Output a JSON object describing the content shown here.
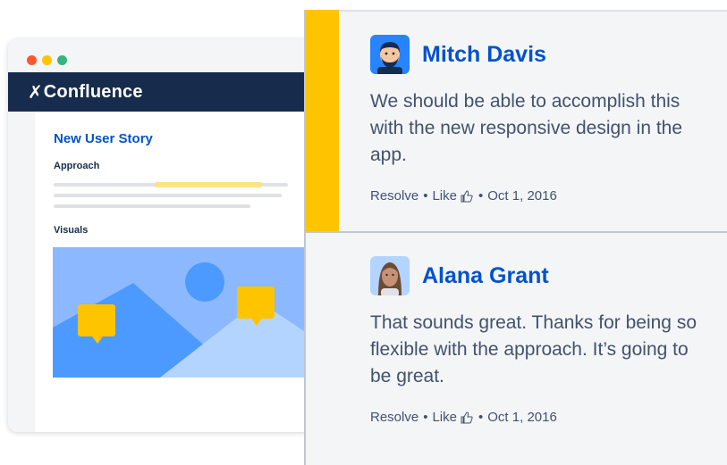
{
  "browser": {
    "window_dots": [
      "red",
      "yellow",
      "green"
    ],
    "app_name": "Confluence",
    "logo_icon": "confluence-x-icon",
    "page": {
      "title": "New User Story",
      "section_approach": "Approach",
      "section_visuals": "Visuals"
    }
  },
  "comments": [
    {
      "author": "Mitch Davis",
      "body": "We should be able to accomplish this with the new responsive design in the app.",
      "actions": {
        "resolve": "Resolve",
        "like": "Like",
        "date": "Oct 1, 2016"
      },
      "highlighted": true
    },
    {
      "author": "Alana Grant",
      "body": "That sounds great. Thanks for being so flexible with the approach. It’s going to be great.",
      "actions": {
        "resolve": "Resolve",
        "like": "Like",
        "date": "Oct 1, 2016"
      },
      "highlighted": false
    }
  ],
  "colors": {
    "accent_yellow": "#ffc400",
    "link_blue": "#0052cc",
    "navy": "#172b4d"
  }
}
